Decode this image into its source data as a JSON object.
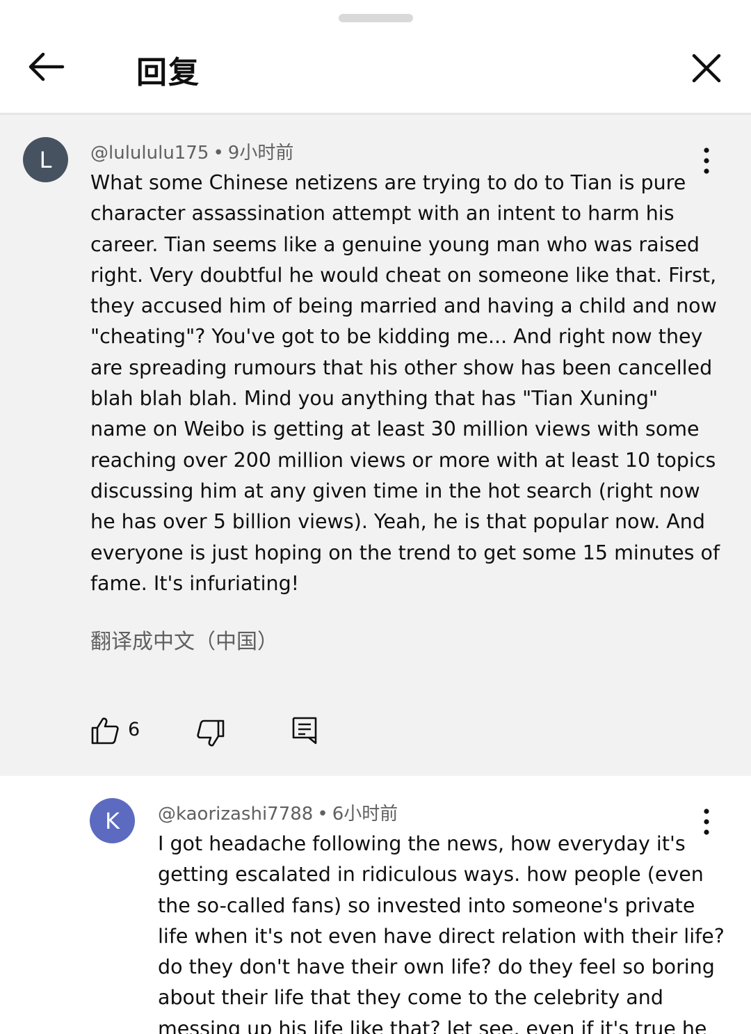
{
  "header": {
    "title": "回复"
  },
  "parent_comment": {
    "avatar_letter": "L",
    "avatar_color": "#475261",
    "author": "@lulululu175",
    "separator": "•",
    "time": "9小时前",
    "lines": [
      "What some Chinese netizens are trying to do to Tian is pure",
      "character assassination attempt with an intent to harm his",
      "career. Tian seems like a genuine young man who was raised",
      "right. Very doubtful he would cheat on someone like that. First,",
      "they accused him of being married and having a child and now",
      "\"cheating\"? You've got to be kidding me... And right now they",
      "are spreading rumours that his other show has been cancelled",
      "blah blah blah. Mind you anything that has \"Tian Xuning\"",
      "name on Weibo is getting at least 30 million views with some",
      "reaching over 200 million views or more with at least 10 topics",
      "discussing him at any given time in the hot search (right now",
      "he has over 5 billion views). Yeah, he is that popular now. And",
      "everyone is just hoping on the trend to get some 15 minutes of",
      "fame. It's infuriating!"
    ],
    "translate_label": "翻译成中文（中国）",
    "like_count": "6",
    "icons": {
      "like": "thumbs-up-icon",
      "dislike": "thumbs-down-icon",
      "reply": "comment-icon",
      "more": "more-vertical-icon"
    }
  },
  "reply_comment": {
    "avatar_letter": "K",
    "avatar_color": "#5c6bc0",
    "author": "@kaorizashi7788",
    "separator": "•",
    "time": "6小时前",
    "lines": [
      "I got headache following the news, how everyday it's",
      "getting escalated in ridiculous ways. how people (even",
      "the so-called fans) so invested into someone's private",
      "life when it's not even have direct relation with their life?",
      "do they don't have their own life? do they feel so boring",
      "about their life that they come to the celebrity and",
      "messing up his life like that? let see, even if it's true he"
    ]
  }
}
